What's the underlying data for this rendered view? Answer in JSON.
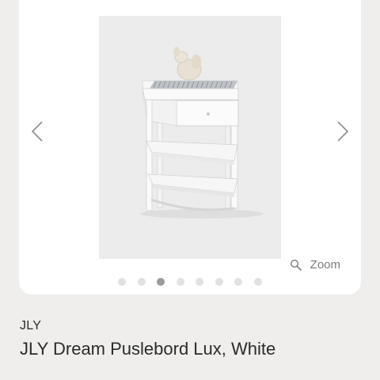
{
  "gallery": {
    "image_alt": "JLY Dream Puslebord Lux, White",
    "prev_icon": "chevron-left-icon",
    "next_icon": "chevron-right-icon",
    "zoom_icon": "magnifier-icon",
    "zoom_label": "Zoom",
    "dot_count": 8,
    "active_dot_index": 2
  },
  "product": {
    "brand": "JLY",
    "title": "JLY Dream Puslebord Lux, White"
  }
}
